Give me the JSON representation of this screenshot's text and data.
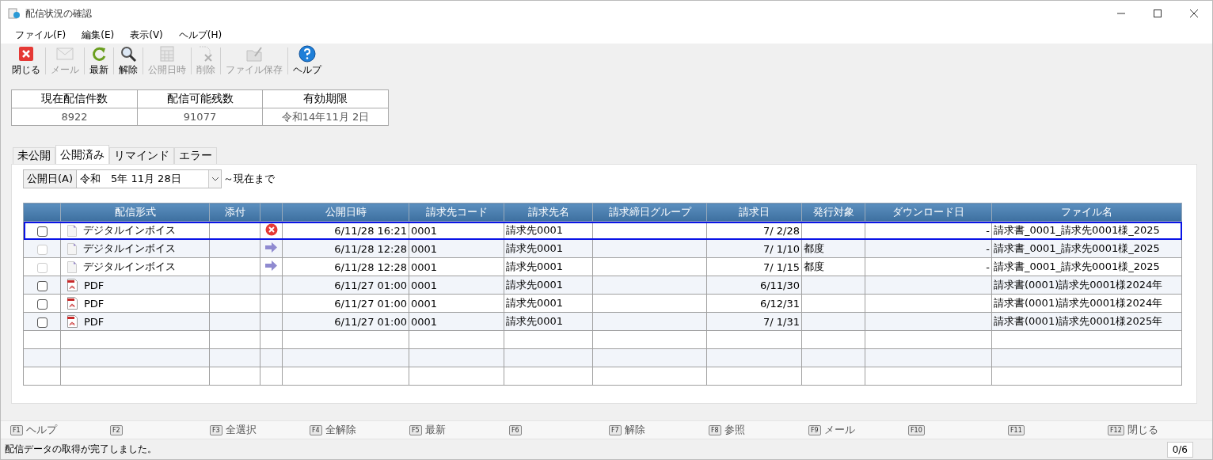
{
  "window": {
    "title": "配信状況の確認"
  },
  "menu": [
    "ファイル(F)",
    "編集(E)",
    "表示(V)",
    "ヘルプ(H)"
  ],
  "toolbar": [
    {
      "kind": "close",
      "label": "閉じる",
      "disabled": false
    },
    {
      "kind": "mail",
      "label": "メール",
      "disabled": true
    },
    {
      "kind": "refresh",
      "label": "最新",
      "disabled": false
    },
    {
      "kind": "search",
      "label": "解除",
      "disabled": false
    },
    {
      "kind": "calendar",
      "label": "公開日時",
      "disabled": true
    },
    {
      "kind": "delete",
      "label": "削除",
      "disabled": true
    },
    {
      "kind": "save",
      "label": "ファイル保存",
      "disabled": true
    },
    {
      "kind": "help",
      "label": "ヘルプ",
      "disabled": false
    }
  ],
  "summary": {
    "columns": [
      "現在配信件数",
      "配信可能残数",
      "有効期限"
    ],
    "values": [
      "8922",
      "91077",
      "令和14年11月 2日"
    ]
  },
  "tabs": [
    {
      "label": "未公開",
      "selected": false
    },
    {
      "label": "公開済み",
      "selected": true
    },
    {
      "label": "リマインド",
      "selected": false
    },
    {
      "label": "エラー",
      "selected": false
    }
  ],
  "filter": {
    "label": "公開日(A)",
    "value": "令和　5年 11月 28日",
    "suffix": "～現在まで"
  },
  "table": {
    "columns": [
      "配信形式",
      "添付",
      "公開日時",
      "請求先コード",
      "請求先名",
      "請求締日グループ",
      "請求日",
      "発行対象",
      "ダウンロード日",
      "ファイル名"
    ],
    "rows": [
      {
        "selected": true,
        "checked": false,
        "disabled": false,
        "format": {
          "kind": "digital",
          "label": "デジタルインボイス"
        },
        "status": {
          "kind": "error"
        },
        "published": "6/11/28 16:21",
        "code": "0001",
        "name": "請求先0001",
        "invoice_date": "7/ 2/28",
        "download": "-",
        "file": "請求書_0001_請求先0001様_2025"
      },
      {
        "selected": false,
        "checked": false,
        "disabled": true,
        "format": {
          "kind": "digital",
          "label": "デジタルインボイス"
        },
        "status": {
          "kind": "sent"
        },
        "published": "6/11/28 12:28",
        "code": "0001",
        "name": "請求先0001",
        "invoice_date": "7/ 1/10",
        "target": "都度",
        "download": "-",
        "file": "請求書_0001_請求先0001様_2025"
      },
      {
        "selected": false,
        "checked": false,
        "disabled": true,
        "format": {
          "kind": "digital",
          "label": "デジタルインボイス"
        },
        "status": {
          "kind": "sent"
        },
        "published": "6/11/28 12:28",
        "code": "0001",
        "name": "請求先0001",
        "invoice_date": "7/ 1/15",
        "target": "都度",
        "download": "-",
        "file": "請求書_0001_請求先0001様_2025"
      },
      {
        "selected": false,
        "checked": false,
        "disabled": false,
        "format": {
          "kind": "pdf",
          "label": "PDF"
        },
        "published": "6/11/27 01:00",
        "code": "0001",
        "name": "請求先0001",
        "invoice_date": "6/11/30",
        "file": "請求書(0001)請求先0001様2024年"
      },
      {
        "selected": false,
        "checked": false,
        "disabled": false,
        "format": {
          "kind": "pdf",
          "label": "PDF"
        },
        "published": "6/11/27 01:00",
        "code": "0001",
        "name": "請求先0001",
        "invoice_date": "6/12/31",
        "file": "請求書(0001)請求先0001様2024年"
      },
      {
        "selected": false,
        "checked": false,
        "disabled": false,
        "format": {
          "kind": "pdf",
          "label": "PDF"
        },
        "published": "6/11/27 01:00",
        "code": "0001",
        "name": "請求先0001",
        "invoice_date": "7/ 1/31",
        "file": "請求書(0001)請求先0001様2025年"
      }
    ]
  },
  "function_keys": [
    {
      "key": "F1",
      "label": "ヘルプ"
    },
    {
      "key": "F2"
    },
    {
      "key": "F3",
      "label": "全選択"
    },
    {
      "key": "F4",
      "label": "全解除"
    },
    {
      "key": "F5",
      "label": "最新"
    },
    {
      "key": "F6"
    },
    {
      "key": "F7",
      "label": "解除"
    },
    {
      "key": "F8",
      "label": "参照"
    },
    {
      "key": "F9",
      "label": "メール"
    },
    {
      "key": "F10"
    },
    {
      "key": "F11"
    },
    {
      "key": "F12",
      "label": "閉じる"
    }
  ],
  "status_bar": {
    "message": "配信データの取得が完了しました。",
    "count": "0/6"
  }
}
